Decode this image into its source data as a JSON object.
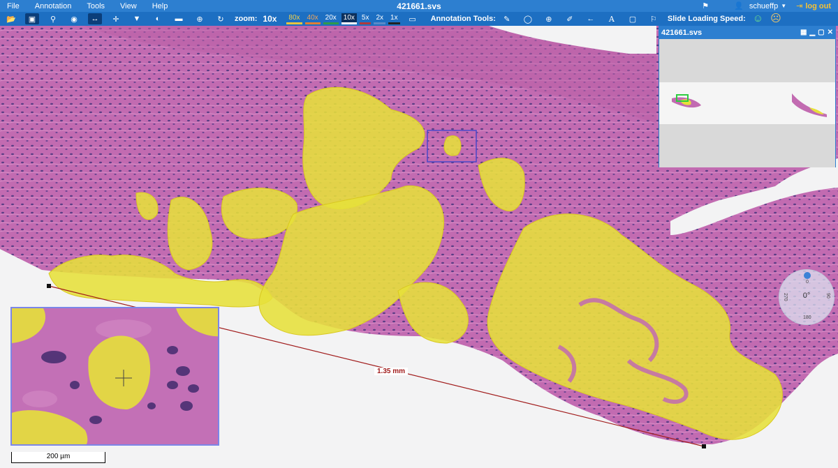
{
  "menubar": {
    "menus": [
      "File",
      "Annotation",
      "Tools",
      "View",
      "Help"
    ],
    "title": "421661.svs",
    "user": "schueffp",
    "logout": "log out"
  },
  "toolbar": {
    "zoom_label": "zoom:",
    "zoom_value": "10x",
    "zoom_levels": [
      "80x",
      "40x",
      "20x",
      "10x",
      "5x",
      "2x",
      "1x"
    ],
    "selected_zoom": "10x",
    "annotation_tools_label": "Annotation Tools:",
    "slide_speed_label": "Slide Loading Speed:",
    "zoom_colors": [
      "#e8c441",
      "#e07f35",
      "#2f9a4b",
      "#ffffff",
      "#b03a3a",
      "#5a8ac8",
      "#222222"
    ]
  },
  "navigator": {
    "title": "421661.svs"
  },
  "measurement": {
    "label": "1.35 mm"
  },
  "scalebar": {
    "label": "200 µm"
  },
  "rotation": {
    "angle": "0°",
    "ticks": [
      "0",
      "90",
      "180",
      "270"
    ]
  },
  "colors": {
    "menubar": "#2d7fd0",
    "toolbar": "#1d6fc2",
    "tissue": "#c66fb5",
    "annotation": "#e6e03a",
    "measure_line": "#a11c1c"
  }
}
